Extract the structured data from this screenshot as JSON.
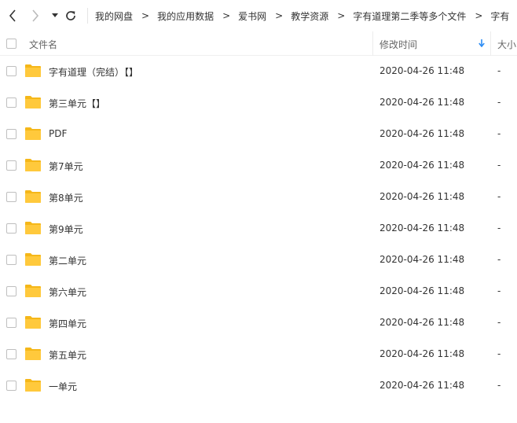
{
  "toolbar": {
    "breadcrumbs": [
      "我的网盘",
      "我的应用数据",
      "爱书网",
      "教学资源",
      "字有道理第二季等多个文件",
      "字有"
    ],
    "separator": ">"
  },
  "columns": {
    "name": "文件名",
    "modified": "修改时间",
    "size": "大小"
  },
  "colors": {
    "folder": "#FFC93C",
    "folder_tab": "#F5B719",
    "sort_arrow": "#2C8CF4"
  },
  "files": [
    {
      "name": "字有道理（完结）【】",
      "modified": "2020-04-26 11:48",
      "size": "-"
    },
    {
      "name": "第三单元【】",
      "modified": "2020-04-26 11:48",
      "size": "-"
    },
    {
      "name": "PDF",
      "modified": "2020-04-26 11:48",
      "size": "-"
    },
    {
      "name": "第7单元",
      "modified": "2020-04-26 11:48",
      "size": "-"
    },
    {
      "name": "第8单元",
      "modified": "2020-04-26 11:48",
      "size": "-"
    },
    {
      "name": "第9单元",
      "modified": "2020-04-26 11:48",
      "size": "-"
    },
    {
      "name": "第二单元",
      "modified": "2020-04-26 11:48",
      "size": "-"
    },
    {
      "name": "第六单元",
      "modified": "2020-04-26 11:48",
      "size": "-"
    },
    {
      "name": "第四单元",
      "modified": "2020-04-26 11:48",
      "size": "-"
    },
    {
      "name": "第五单元",
      "modified": "2020-04-26 11:48",
      "size": "-"
    },
    {
      "name": "一单元",
      "modified": "2020-04-26 11:48",
      "size": "-"
    }
  ]
}
